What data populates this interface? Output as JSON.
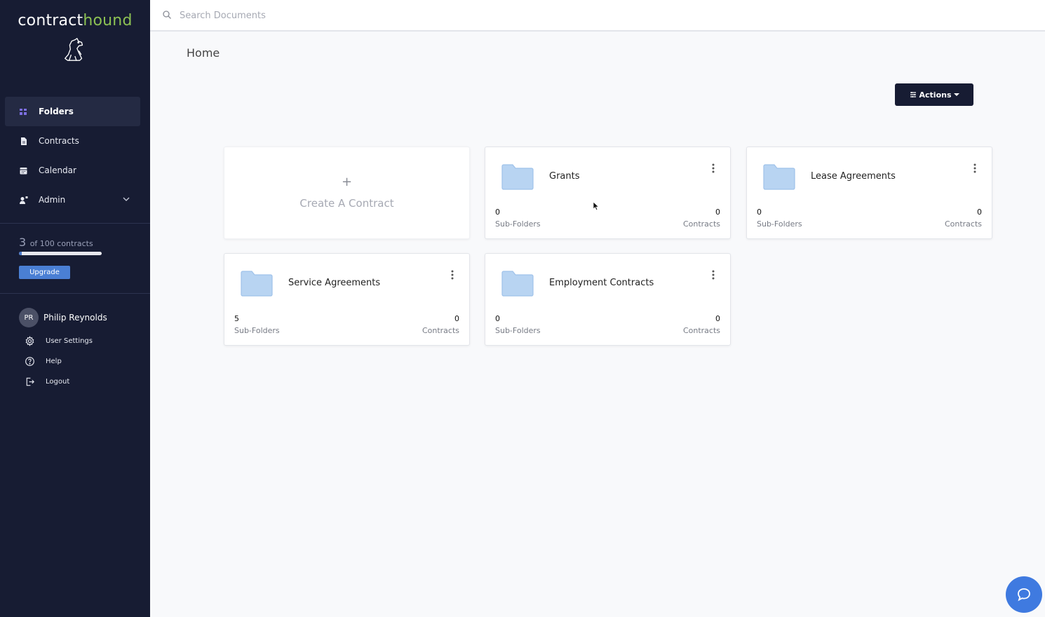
{
  "brand": {
    "name_part1": "contract",
    "name_part2": "hound"
  },
  "sidebar": {
    "items": [
      {
        "label": "Folders",
        "icon": "folders-icon"
      },
      {
        "label": "Contracts",
        "icon": "document-icon"
      },
      {
        "label": "Calendar",
        "icon": "calendar-icon"
      },
      {
        "label": "Admin",
        "icon": "admin-icon"
      }
    ],
    "usage": {
      "used": "3",
      "of_text": "of 100 contracts",
      "fraction": 0.03
    },
    "upgrade_label": "Upgrade",
    "user": {
      "initials": "PR",
      "name": "Philip Reynolds",
      "menu": [
        {
          "label": "User Settings",
          "icon": "gear-icon"
        },
        {
          "label": "Help",
          "icon": "help-icon"
        },
        {
          "label": "Logout",
          "icon": "logout-icon"
        }
      ]
    }
  },
  "search": {
    "placeholder": "Search Documents"
  },
  "page": {
    "title": "Home"
  },
  "toolbar": {
    "actions_label": "Actions"
  },
  "create": {
    "plus": "+",
    "label": "Create A Contract"
  },
  "folders": [
    {
      "name": "Grants",
      "subfolders": "0",
      "contracts": "0"
    },
    {
      "name": "Lease Agreements",
      "subfolders": "0",
      "contracts": "0"
    },
    {
      "name": "Service Agreements",
      "subfolders": "5",
      "contracts": "0"
    },
    {
      "name": "Employment Contracts",
      "subfolders": "0",
      "contracts": "0"
    }
  ],
  "labels": {
    "subfolders": "Sub-Folders",
    "contracts": "Contracts"
  },
  "colors": {
    "sidebar_bg": "#171c33",
    "brand_accent": "#8cc153",
    "primary_blue": "#4a7fd4",
    "folder": "#b8d4f2"
  }
}
